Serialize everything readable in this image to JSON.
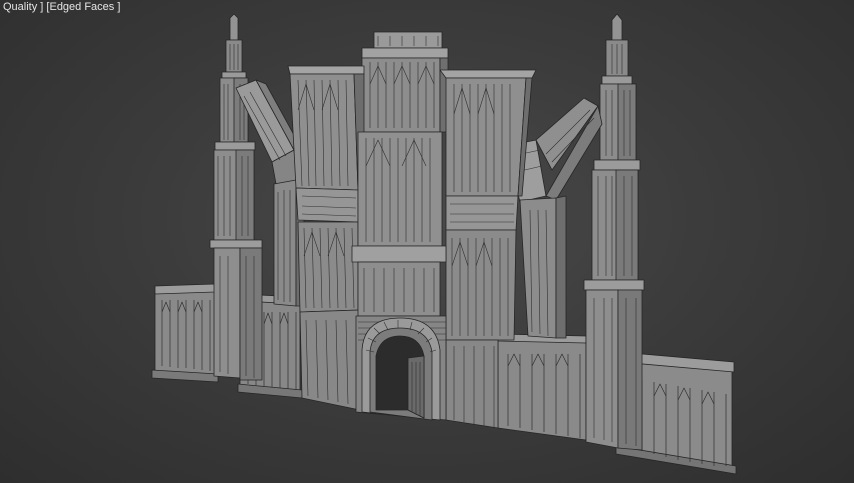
{
  "viewport": {
    "label": {
      "quality": "Quality ]",
      "shading": "[Edged Faces ]"
    }
  },
  "model": {
    "type": "gothic-cathedral-facade",
    "display_mode": "edged-faces",
    "colors": {
      "face": "#8c8c8c",
      "face_dark": "#6e6e6e",
      "face_light": "#9d9d9d",
      "edge": "#2a2a2a",
      "background": "#3c3c3c"
    }
  }
}
